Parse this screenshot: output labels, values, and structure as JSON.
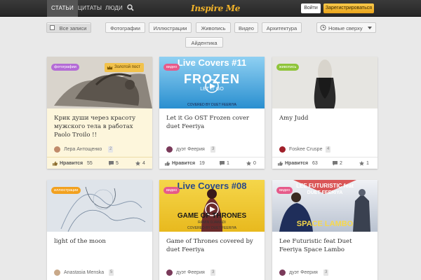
{
  "nav": {
    "items": [
      {
        "label": "Статьи"
      },
      {
        "label": "Цитаты"
      },
      {
        "label": "Люди"
      }
    ],
    "logo": "Inspire Me",
    "login": "Войти",
    "register": "Зарегистрироваться"
  },
  "filters": {
    "all": "Все записи",
    "photo": "Фотографии",
    "illustrations": "Иллюстрации",
    "painting": "Живопись",
    "video": "Видео",
    "architecture": "Архитектура",
    "sort": "Новые сверху",
    "identity": "Айдентика"
  },
  "cards": [
    {
      "tag": "фотографии",
      "badge": "Золотой пост",
      "title": "Крик души через красоту мужского тела в работах Paolo Troilo !!",
      "author": "Лера Антощенко",
      "author_count": "2",
      "likes_label": "Нравится",
      "likes": "55",
      "comments": "5",
      "favs": "4"
    },
    {
      "tag": "видео",
      "video_header": "Live Covers #11",
      "video_title": "FROZEN",
      "video_sub": "LET IT GO",
      "video_credit": "COVERED BY DUET FEERIYA",
      "title": "Let it Go OST Frozen cover duet Feeriya",
      "author": "дуэт Феерия",
      "author_count": "3",
      "likes_label": "Нравится",
      "likes": "19",
      "comments": "1",
      "favs": "0"
    },
    {
      "tag": "живопись",
      "title": "Amy Judd",
      "author": "Foskee Cruspe",
      "author_count": "4",
      "likes_label": "Нравится",
      "likes": "63",
      "comments": "2",
      "favs": "1"
    },
    {
      "tag": "иллюстрации",
      "title": "light of the moon",
      "author": "Anastasia Menska",
      "author_count": "5"
    },
    {
      "tag": "видео",
      "video_header": "Live Covers #08",
      "video_title": "GAME OF THRONES",
      "video_sub": "RAMIN DJAWADI",
      "video_credit": "COVERED BY DUET FEERIYA",
      "title": "Game of Thrones covered by duet Feeriya",
      "author": "дуэт Феерия",
      "author_count": "3"
    },
    {
      "tag": "видео",
      "video_header": "LEE FUTURISTIC feat",
      "video_title": "SPACE LAMBO",
      "video_sub": "DUET FEERIYA",
      "title": "Lee Futuristic feat Duet Feeriya Space Lambo",
      "author": "дуэт Феерия",
      "author_count": "3"
    }
  ],
  "colors": {
    "topbar": "#2e2e2e",
    "accent": "#f0b22a",
    "tag_photo": "#b46bd6",
    "tag_video": "#e65a8a",
    "tag_painting": "#8fc43a",
    "tag_illustration": "#f2a11f"
  },
  "icons": [
    "search-icon",
    "checkbox-icon",
    "clock-icon",
    "chevron-down-icon",
    "crown-icon",
    "like-icon",
    "comment-icon",
    "star-icon",
    "play-icon",
    "avatar"
  ]
}
